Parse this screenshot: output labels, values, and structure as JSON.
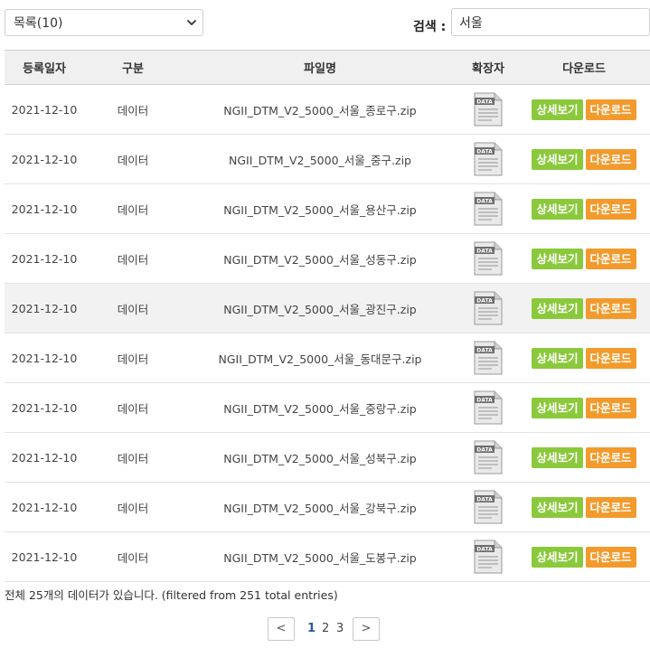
{
  "controls": {
    "page_size_selected": "목록(10)",
    "search_label": "검색 :",
    "search_value": "서울"
  },
  "table": {
    "headers": [
      "등록일자",
      "구분",
      "파일명",
      "확장자",
      "다운로드"
    ],
    "rows": [
      {
        "date": "2021-12-10",
        "type": "데이터",
        "filename": "NGII_DTM_V2_5000_서울_종로구.zip",
        "detail": "상세보기",
        "download": "다운로드"
      },
      {
        "date": "2021-12-10",
        "type": "데이터",
        "filename": "NGII_DTM_V2_5000_서울_중구.zip",
        "detail": "상세보기",
        "download": "다운로드"
      },
      {
        "date": "2021-12-10",
        "type": "데이터",
        "filename": "NGII_DTM_V2_5000_서울_용산구.zip",
        "detail": "상세보기",
        "download": "다운로드"
      },
      {
        "date": "2021-12-10",
        "type": "데이터",
        "filename": "NGII_DTM_V2_5000_서울_성동구.zip",
        "detail": "상세보기",
        "download": "다운로드"
      },
      {
        "date": "2021-12-10",
        "type": "데이터",
        "filename": "NGII_DTM_V2_5000_서울_광진구.zip",
        "detail": "상세보기",
        "download": "다운로드"
      },
      {
        "date": "2021-12-10",
        "type": "데이터",
        "filename": "NGII_DTM_V2_5000_서울_동대문구.zip",
        "detail": "상세보기",
        "download": "다운로드"
      },
      {
        "date": "2021-12-10",
        "type": "데이터",
        "filename": "NGII_DTM_V2_5000_서울_중랑구.zip",
        "detail": "상세보기",
        "download": "다운로드"
      },
      {
        "date": "2021-12-10",
        "type": "데이터",
        "filename": "NGII_DTM_V2_5000_서울_성북구.zip",
        "detail": "상세보기",
        "download": "다운로드"
      },
      {
        "date": "2021-12-10",
        "type": "데이터",
        "filename": "NGII_DTM_V2_5000_서울_강북구.zip",
        "detail": "상세보기",
        "download": "다운로드"
      },
      {
        "date": "2021-12-10",
        "type": "데이터",
        "filename": "NGII_DTM_V2_5000_서울_도봉구.zip",
        "detail": "상세보기",
        "download": "다운로드"
      }
    ],
    "ext_icon_label": "DATA",
    "ext_icon_name": "data-file-icon"
  },
  "summary": "전체 25개의 데이터가 있습니다. (filtered from 251 total entries)",
  "pagination": {
    "prev": "<",
    "pages": [
      "1",
      "2",
      "3"
    ],
    "current": "1",
    "next": ">"
  },
  "colors": {
    "detail_button": "#8bc93c",
    "download_button": "#f39a2c",
    "header_bg": "#f0f0f0",
    "active_page": "#2a58a8"
  }
}
